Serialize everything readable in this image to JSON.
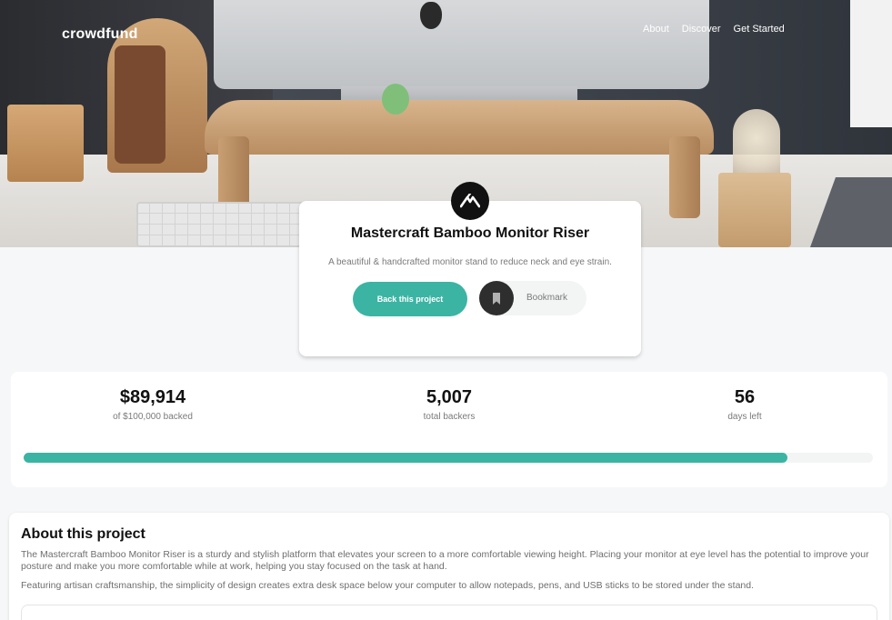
{
  "nav": {
    "logo": "crowdfund",
    "links": [
      "About",
      "Discover",
      "Get Started"
    ]
  },
  "project": {
    "title": "Mastercraft Bamboo Monitor Riser",
    "description": "A beautiful & handcrafted monitor stand to reduce neck and eye strain.",
    "back_label": "Back this project",
    "bookmark_label": "Bookmark"
  },
  "stats": {
    "backed_amount": "$89,914",
    "backed_label": "of $100,000 backed",
    "backers": "5,007",
    "backers_label": "total backers",
    "days": "56",
    "days_label": "days left",
    "progress_fraction": 0.89914
  },
  "about": {
    "title": "About this project",
    "p1": "The Mastercraft Bamboo Monitor Riser is a sturdy and stylish platform that elevates your screen to a more comfortable viewing height. Placing your monitor at eye level has the potential to improve your posture and make you more comfortable while at work, helping you stay focused on the task at hand.",
    "p2": "Featuring artisan craftsmanship, the simplicity of design creates extra desk space below your computer to allow notepads, pens, and USB sticks to be stored under the stand."
  },
  "colors": {
    "accent": "#3cb4a4",
    "dark": "#111111",
    "muted": "#7a7a7a"
  },
  "icons": {
    "product_logo": "mastercraft-logo-icon",
    "bookmark": "bookmark-icon"
  }
}
